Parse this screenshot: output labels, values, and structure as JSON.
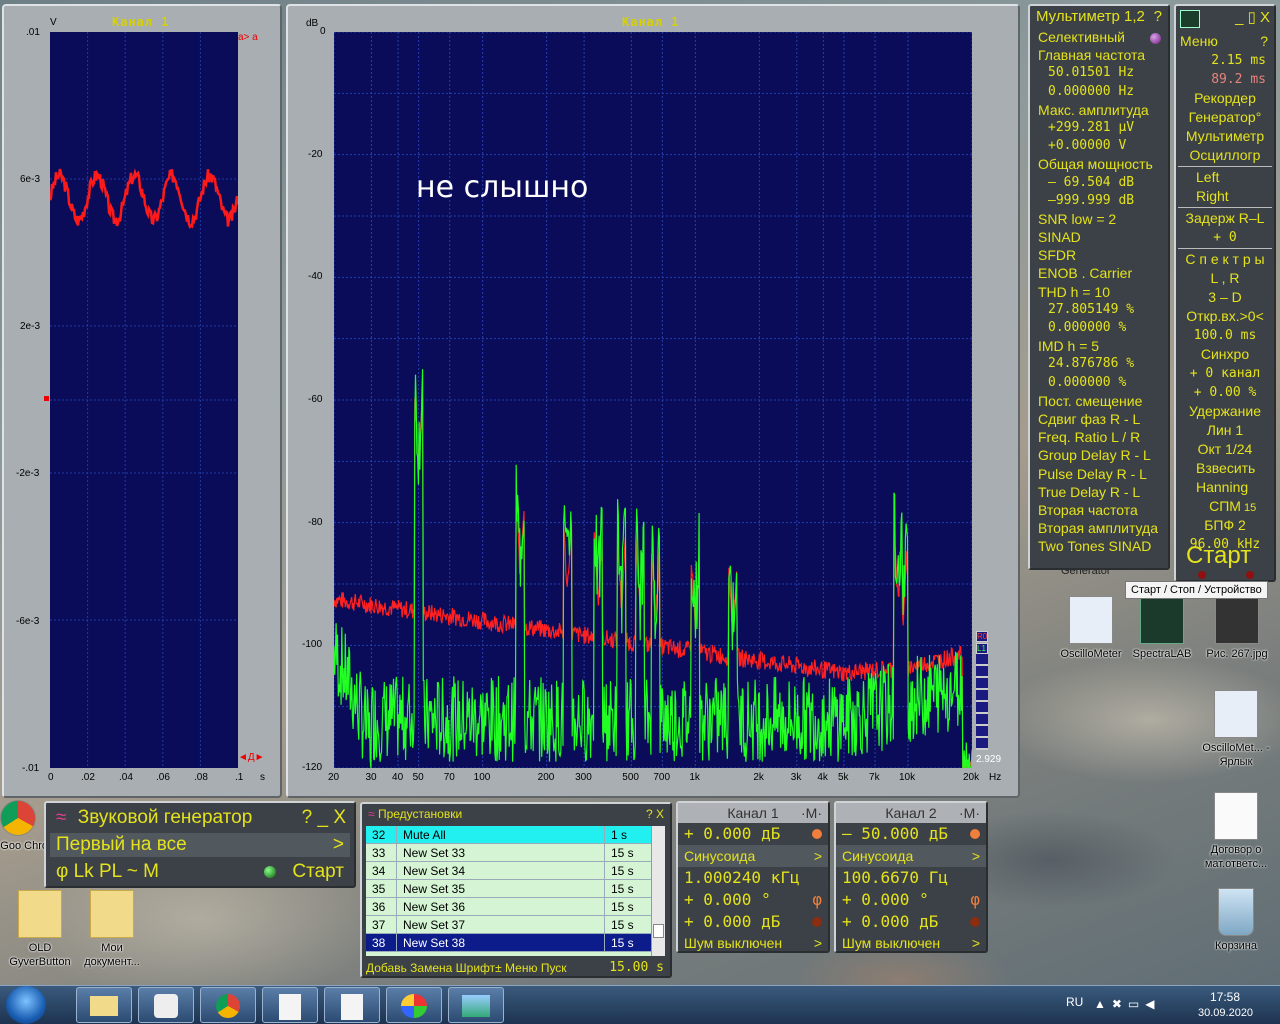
{
  "channel1_panel": {
    "title": "Канал 1",
    "y_unit": "V",
    "y_ticks": [
      ".01",
      "6e-3",
      "2e-3",
      "-2e-3",
      "-6e-3",
      "-.01"
    ],
    "x_ticks": [
      "0",
      ".02",
      ".04",
      ".06",
      ".08",
      ".1"
    ],
    "x_unit": "s"
  },
  "spectrum_panel": {
    "title": "Канал 1",
    "y_unit": "dB",
    "y_ticks": [
      "0",
      "-20",
      "-40",
      "-60",
      "-80",
      "-100",
      "-120"
    ],
    "x_ticks": [
      "20",
      "30",
      "40",
      "50",
      "70",
      "100",
      "200",
      "300",
      "500",
      "700",
      "1k",
      "2k",
      "3k",
      "4k",
      "5k",
      "7k",
      "10k",
      "20k"
    ],
    "x_unit": "Hz",
    "overlay_text": "не слышно",
    "corner_value": "2.929",
    "legend_r": "R0",
    "legend_l": "L1"
  },
  "chart_data": {
    "type": "line",
    "xlabel": "Hz",
    "ylabel": "dB",
    "ylim": [
      -120,
      0
    ],
    "x_scale": "log",
    "series": [
      {
        "name": "R",
        "color": "#ff2020"
      },
      {
        "name": "L",
        "color": "#20ff20"
      }
    ]
  },
  "multimeter": {
    "title": "Мультиметр 1,2",
    "help": "?",
    "rows": [
      {
        "t": "Селективный",
        "cls": ""
      },
      {
        "t": "Главная частота",
        "cls": ""
      },
      {
        "t": "50.01501  Hz",
        "cls": "val"
      },
      {
        "t": "0.000000  Hz",
        "cls": "val"
      },
      {
        "t": "Макс. амплитуда",
        "cls": ""
      },
      {
        "t": "+299.281 μV",
        "cls": "val"
      },
      {
        "t": "+0.00000  V",
        "cls": "val"
      },
      {
        "t": "Общая мощность",
        "cls": ""
      },
      {
        "t": "– 69.504 dB",
        "cls": "val"
      },
      {
        "t": "–999.999 dB",
        "cls": "val"
      },
      {
        "t": "SNR      low =   2",
        "cls": ""
      },
      {
        "t": "SINAD",
        "cls": ""
      },
      {
        "t": "SFDR",
        "cls": ""
      },
      {
        "t": "ENOB . Carrier",
        "cls": ""
      },
      {
        "t": "THD       h =   10",
        "cls": ""
      },
      {
        "t": "27.805149 %",
        "cls": "val"
      },
      {
        "t": "0.000000 %",
        "cls": "val"
      },
      {
        "t": "IMD       h =    5",
        "cls": ""
      },
      {
        "t": "24.876786 %",
        "cls": "val"
      },
      {
        "t": "0.000000 %",
        "cls": "val"
      },
      {
        "t": "Пост. смещение",
        "cls": ""
      },
      {
        "t": "Сдвиг фаз R - L",
        "cls": ""
      },
      {
        "t": "Freq. Ratio  L / R",
        "cls": ""
      },
      {
        "t": "Group Delay R - L",
        "cls": ""
      },
      {
        "t": "Pulse Delay R - L",
        "cls": ""
      },
      {
        "t": "True Delay R - L",
        "cls": ""
      },
      {
        "t": "Вторая частота",
        "cls": ""
      },
      {
        "t": "Вторая амплитуда",
        "cls": ""
      },
      {
        "t": "Two Tones SINAD",
        "cls": ""
      }
    ]
  },
  "side_menu": {
    "title_controls": "_ ▯ X",
    "menu": "Меню",
    "help": "?",
    "t1": "2.15 ms",
    "t2": "89.2 ms",
    "items": [
      "Рекордер",
      "Генератор°",
      "Мультиметр",
      "Осциллогр",
      "Left",
      "Right",
      "Задерж  R–L",
      "+          0",
      "С п е к т р ы",
      "L , R",
      "3 – D",
      "Откр.вх.>0<",
      "100.0 ms",
      "Синхро",
      "+  0 канал",
      "+  0.00 %",
      "Удержание",
      "Лин          1",
      "Окт   1/24",
      "Взвесить",
      "Hanning",
      "СПМ",
      "БПФ   2",
      "96.00 kHz"
    ],
    "fft_exp": "15",
    "start": "Старт"
  },
  "tooltip": "Старт / Стоп / Устройство",
  "generator": {
    "title": "Звуковой генератор",
    "controls": "?  _  X",
    "mode": "Первый на все",
    "row3": "φ  Lk  PL  ~  M",
    "start": "Старт"
  },
  "presets": {
    "title": "Предустановки",
    "controls": "?  X",
    "rows": [
      {
        "n": "32",
        "name": "Mute All",
        "t": "1 s"
      },
      {
        "n": "33",
        "name": "New Set 33",
        "t": "15 s"
      },
      {
        "n": "34",
        "name": "New Set 34",
        "t": "15 s"
      },
      {
        "n": "35",
        "name": "New Set 35",
        "t": "15 s"
      },
      {
        "n": "36",
        "name": "New Set 36",
        "t": "15 s"
      },
      {
        "n": "37",
        "name": "New Set 37",
        "t": "15 s"
      },
      {
        "n": "38",
        "name": "New Set 38",
        "t": "15 s"
      }
    ],
    "footer": "Добавь  Замена  Шрифт±  Меню  Пуск",
    "footer_value": "15.00 s"
  },
  "channel1_gen": {
    "title": "Канал 1",
    "m": "·M·",
    "level": "+   0.000 дБ",
    "wave": "Синусоида",
    "freq": "1.000240 кГц",
    "phase": "+   0.000 °",
    "offset": "+   0.000 дБ",
    "noise": "Шум выключен"
  },
  "channel2_gen": {
    "title": "Канал 2",
    "m": "·M·",
    "level": "–  50.000 дБ",
    "wave": "Синусоида",
    "freq": "100.6670   Гц",
    "phase": "+   0.000 °",
    "offset": "+   0.000 дБ",
    "noise": "Шум выключен"
  },
  "desktop_icons": [
    {
      "label": "OscilloMeter",
      "name": "oscillometer-shortcut"
    },
    {
      "label": "SpectraLAB",
      "name": "spectralab-shortcut"
    },
    {
      "label": "Рис. 267.jpg",
      "name": "image-file"
    },
    {
      "label": "OscilloMet... - Ярлык",
      "name": "oscillometer-link"
    },
    {
      "label": "Договор о мат.ответс...",
      "name": "docx-file"
    },
    {
      "label": "Корзина",
      "name": "recycle-bin"
    },
    {
      "label": "OLD GyverButton",
      "name": "old-gyverbutton-folder"
    },
    {
      "label": "Мои документ...",
      "name": "my-documents"
    },
    {
      "label": "Goo Chro",
      "name": "chrome-shortcut"
    }
  ],
  "generator_label": "Generator",
  "taskbar": {
    "lang": "RU",
    "time": "17:58",
    "date": "30.09.2020"
  }
}
